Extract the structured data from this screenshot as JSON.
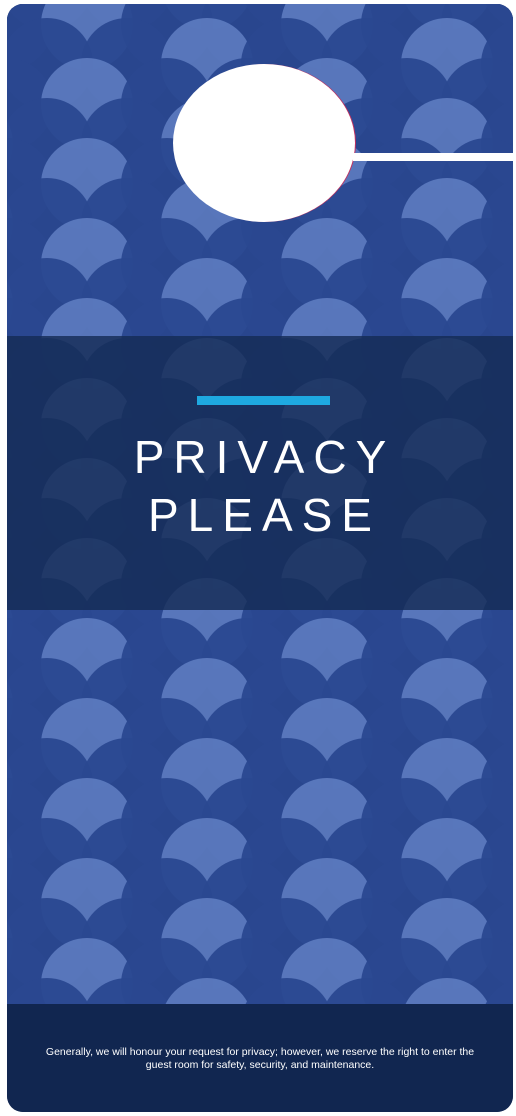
{
  "hanger": {
    "title_line1": "PRIVACY",
    "title_line2": "PLEASE",
    "footer_text": "Generally, we will honour your request for privacy; however, we reserve the right to enter the guest room for safety, security, and maintenance."
  },
  "colors": {
    "background": "#1a3260",
    "accent": "#1ea9e1",
    "footer": "#112650",
    "scale_dark": "#14214a",
    "scale_mid": "#2a4890",
    "scale_light": "#5b79be",
    "text": "#ffffff"
  },
  "icons": {
    "hanger_hole": "door-hanger-hole",
    "hanger_slit": "door-hanger-slit"
  }
}
